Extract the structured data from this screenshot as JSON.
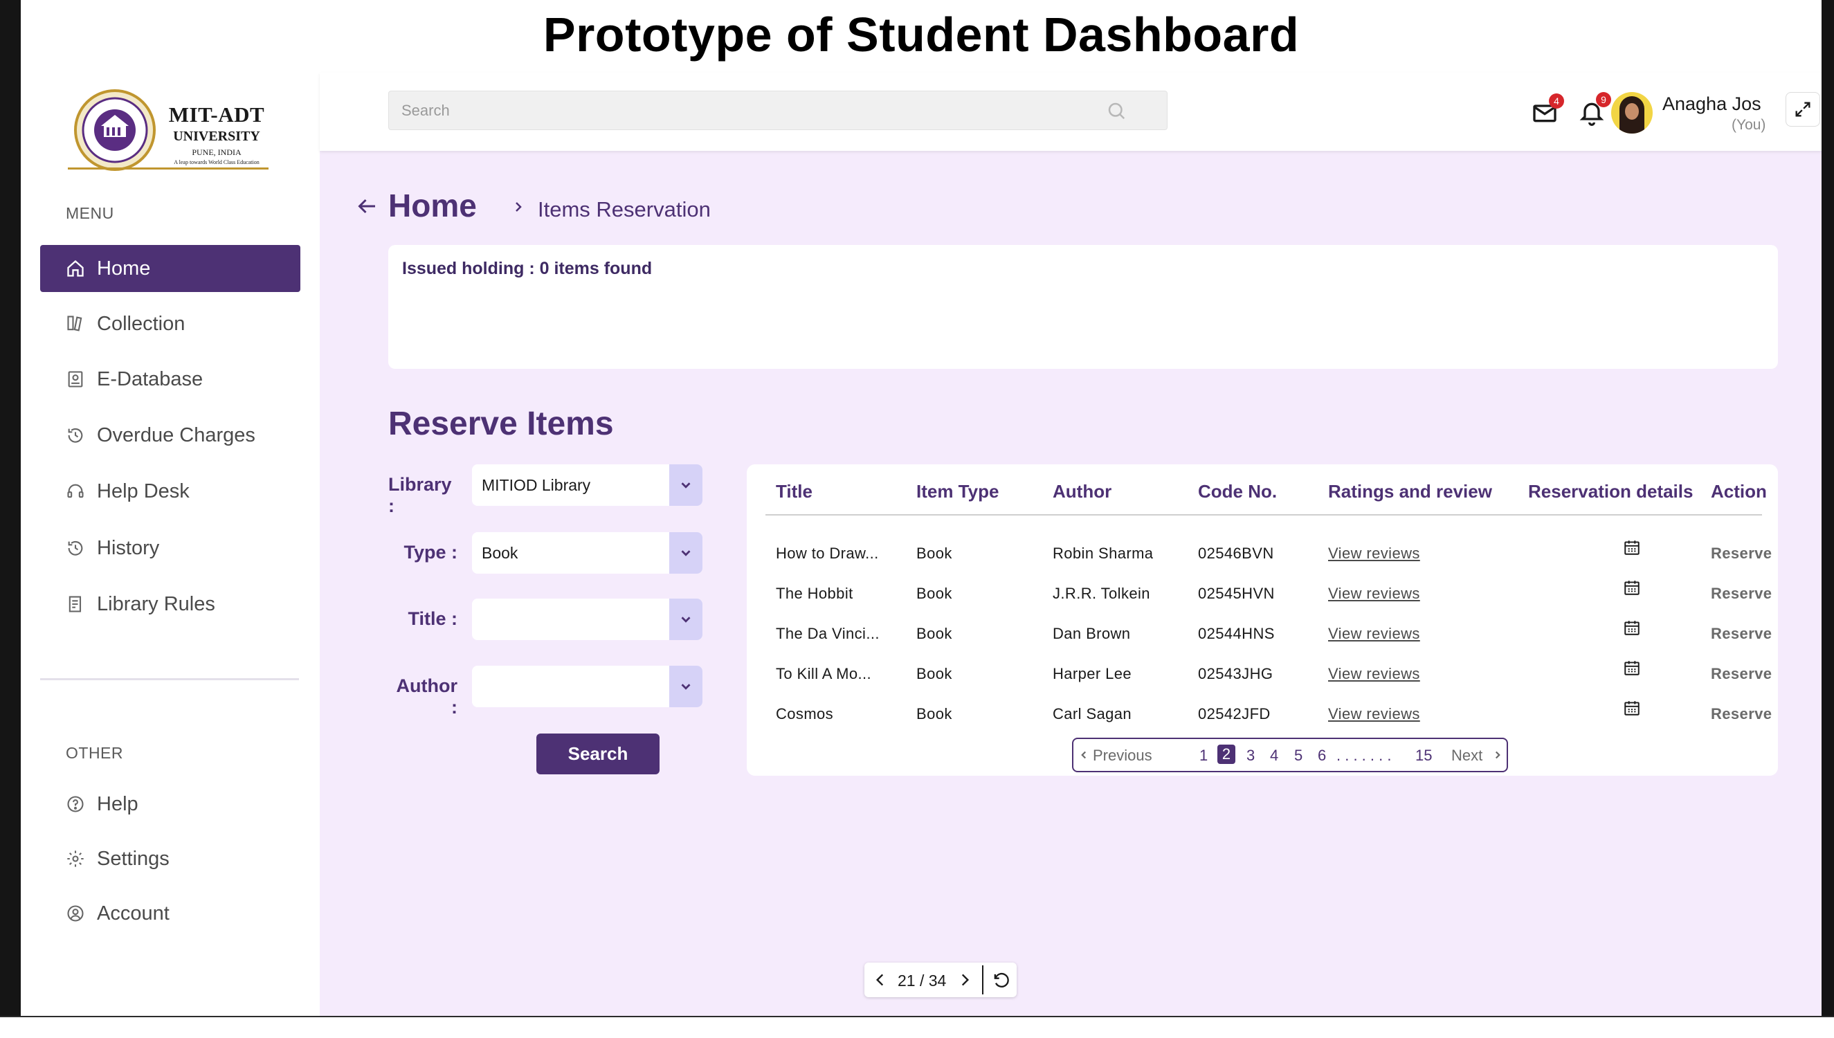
{
  "slide_title": "Prototype of Student Dashboard",
  "logo": {
    "line1": "MIT-ADT",
    "line2": "UNIVERSITY",
    "line3": "PUNE, INDIA",
    "line4": "A leap towards World Class Education"
  },
  "sidebar": {
    "menu_heading": "MENU",
    "menu_items": [
      {
        "label": "Home",
        "icon": "home-icon",
        "active": true
      },
      {
        "label": "Collection",
        "icon": "collection-icon"
      },
      {
        "label": "E-Database",
        "icon": "database-icon"
      },
      {
        "label": "Overdue Charges",
        "icon": "overdue-icon"
      },
      {
        "label": "Help Desk",
        "icon": "headset-icon"
      },
      {
        "label": "History",
        "icon": "history-icon"
      },
      {
        "label": "Library Rules",
        "icon": "rules-icon"
      }
    ],
    "other_heading": "OTHER",
    "other_items": [
      {
        "label": "Help",
        "icon": "help-icon"
      },
      {
        "label": "Settings",
        "icon": "gear-icon"
      },
      {
        "label": "Account",
        "icon": "account-icon"
      }
    ]
  },
  "topbar": {
    "search_placeholder": "Search",
    "mail_count": "4",
    "notification_count": "9",
    "user_name": "Anagha Jos",
    "user_sub": "(You)"
  },
  "breadcrumb": {
    "home": "Home",
    "page": "Items Reservation"
  },
  "issued": {
    "text": "Issued holding : 0 items found"
  },
  "reserve": {
    "title": "Reserve Items",
    "filters": {
      "library_label": "Library :",
      "library_value": "MITIOD Library",
      "type_label": "Type :",
      "type_value": "Book",
      "title_label": "Title :",
      "title_value": "",
      "author_label": "Author :",
      "author_value": ""
    },
    "search_button": "Search"
  },
  "table": {
    "columns": [
      "Title",
      "Item Type",
      "Author",
      "Code No.",
      "Ratings and review",
      "Reservation details",
      "Action"
    ],
    "rows": [
      {
        "title": "How to Draw...",
        "type": "Book",
        "author": "Robin Sharma",
        "code": "02546BVN",
        "review": "View reviews",
        "action": "Reserve"
      },
      {
        "title": "The Hobbit",
        "type": "Book",
        "author": "J.R.R. Tolkein",
        "code": "02545HVN",
        "review": "View reviews",
        "action": "Reserve"
      },
      {
        "title": "The Da Vinci...",
        "type": "Book",
        "author": "Dan Brown",
        "code": "02544HNS",
        "review": "View reviews",
        "action": "Reserve"
      },
      {
        "title": "To Kill A Mo...",
        "type": "Book",
        "author": "Harper Lee",
        "code": "02543JHG",
        "review": "View reviews",
        "action": "Reserve"
      },
      {
        "title": "Cosmos",
        "type": "Book",
        "author": "Carl Sagan",
        "code": "02542JFD",
        "review": "View reviews",
        "action": "Reserve"
      }
    ],
    "pagination": {
      "previous": "Previous",
      "pages": [
        "1",
        "2",
        "3",
        "4",
        "5",
        "6"
      ],
      "current": "2",
      "ellipsis": ". . . . . . .",
      "last": "15",
      "next": "Next"
    }
  },
  "pdf_nav": {
    "page_indicator": "21 / 34"
  },
  "colors": {
    "primary": "#4d3174",
    "main_bg": "#f5ebfc",
    "badge": "#d6262b",
    "select_arrow_bg": "#d6d2f7"
  }
}
